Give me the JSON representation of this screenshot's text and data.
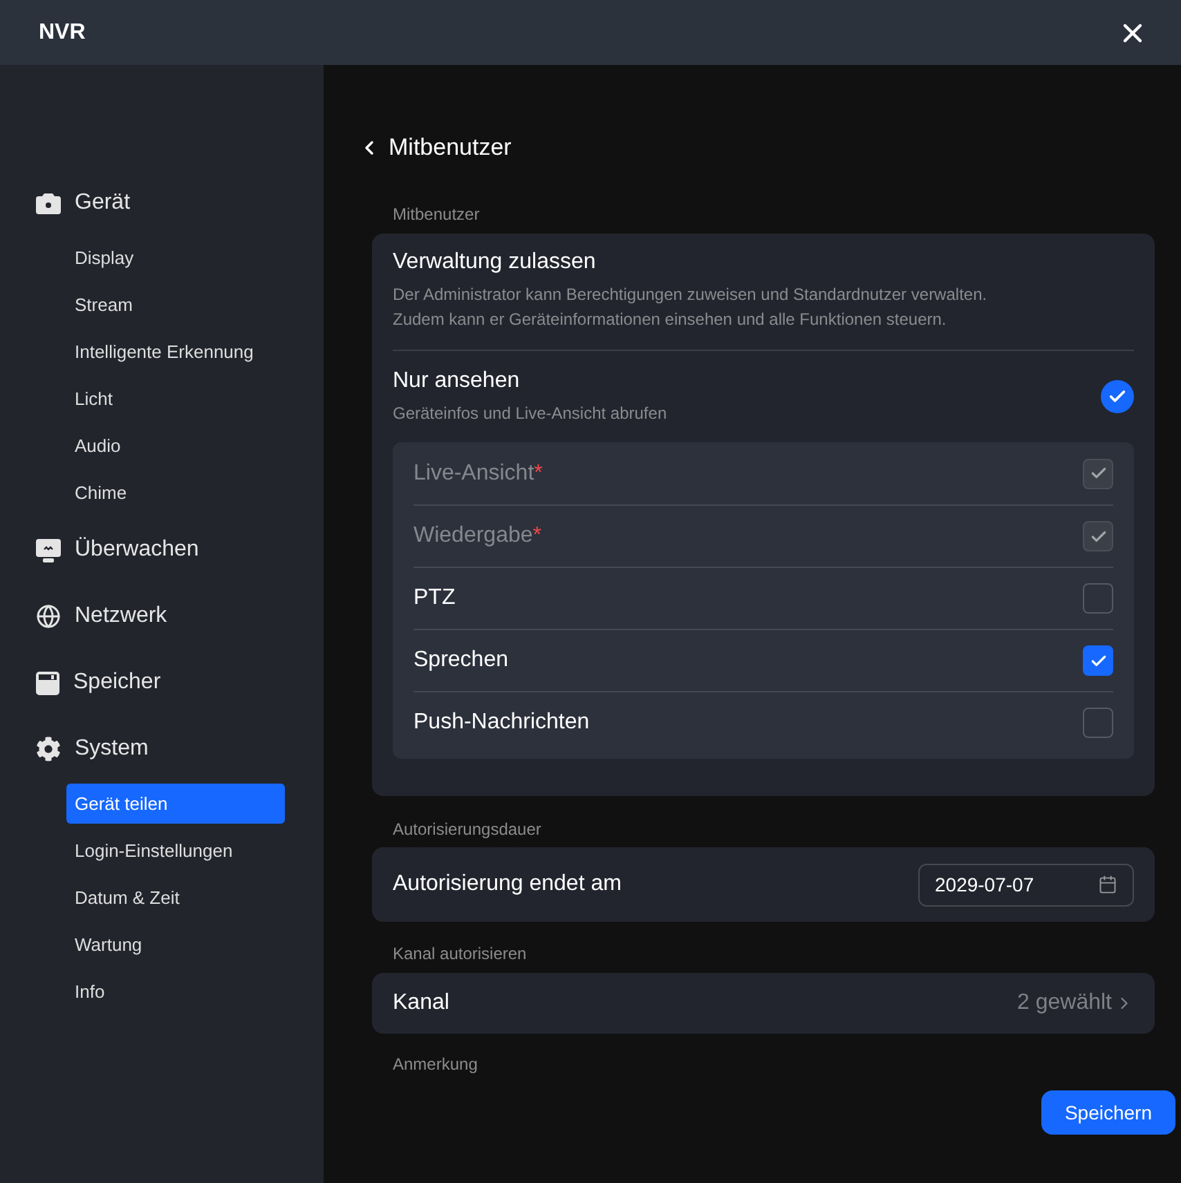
{
  "window": {
    "title": "NVR"
  },
  "sidebar": {
    "groups": [
      {
        "label": "Gerät",
        "items": [
          {
            "label": "Display",
            "selected": false
          },
          {
            "label": "Stream",
            "selected": false
          },
          {
            "label": "Intelligente Erkennung",
            "selected": false
          },
          {
            "label": "Licht",
            "selected": false
          },
          {
            "label": "Audio",
            "selected": false
          },
          {
            "label": "Chime",
            "selected": false
          }
        ]
      },
      {
        "label": "Überwachen"
      },
      {
        "label": "Netzwerk"
      },
      {
        "label": "Speicher"
      },
      {
        "label": "System",
        "items": [
          {
            "label": "Gerät teilen",
            "selected": true
          },
          {
            "label": "Login-Einstellungen",
            "selected": false
          },
          {
            "label": "Datum & Zeit",
            "selected": false
          },
          {
            "label": "Wartung",
            "selected": false
          },
          {
            "label": "Info",
            "selected": false
          }
        ]
      }
    ]
  },
  "page": {
    "title": "Mitbenutzer"
  },
  "sharing": {
    "label": "Mitbenutzer",
    "options": [
      {
        "title": "Verwaltung zulassen",
        "description": "Der Administrator kann Berechtigungen zuweisen und Standardnutzer verwalten.\nZudem kann er Geräteinformationen einsehen und alle Funktionen steuern.",
        "selected": false
      },
      {
        "title": "Nur ansehen",
        "description": "Geräteinfos und Live-Ansicht abrufen",
        "selected": true
      }
    ],
    "permissions": [
      {
        "label": "Live-Ansicht",
        "required_mark": "*",
        "checked": true,
        "disabled": true
      },
      {
        "label": "Wiedergabe",
        "required_mark": "*",
        "checked": true,
        "disabled": true
      },
      {
        "label": "PTZ",
        "checked": false,
        "disabled": false
      },
      {
        "label": "Sprechen",
        "checked": true,
        "disabled": false
      },
      {
        "label": "Push-Nachrichten",
        "checked": false,
        "disabled": false
      }
    ]
  },
  "duration": {
    "label": "Autorisierungsdauer",
    "row_label": "Autorisierung endet am",
    "date_field": {
      "value": "2029-07-07"
    }
  },
  "channels": {
    "label": "Kanal autorisieren",
    "row_label": "Kanal",
    "value": "2 gewählt"
  },
  "note": {
    "label": "Anmerkung"
  },
  "save_button": {
    "label": "Speichern"
  }
}
